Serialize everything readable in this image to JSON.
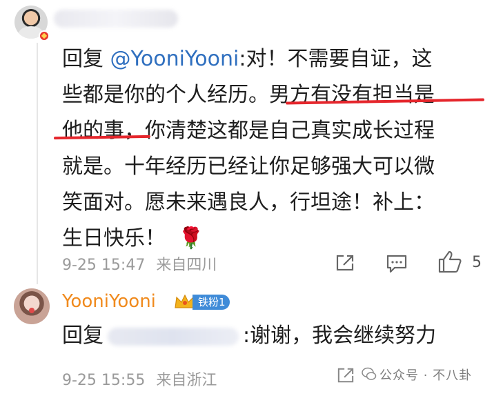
{
  "comment": {
    "reply_prefix": "回复",
    "mention": "@YooniYooni",
    "lines": [
      ":对！不需要自证，这",
      "些都是你的个人经历。男方有没有担当是",
      "他的事，你清楚这都是自己真实成长过程",
      "就是。十年经历已经让你足够强大可以微",
      "笑面对。愿未来遇良人，行坦途！补上：",
      "生日快乐！"
    ],
    "emoji": "🌹",
    "date": "9-25 15:47",
    "location": "来自四川",
    "like_count": "5"
  },
  "reply": {
    "username": "YooniYooni",
    "fan_badge": "铁粉1",
    "reply_prefix": "回复",
    "text": ":谢谢，我会继续努力",
    "date": "9-25 15:55",
    "location": "来自浙江"
  },
  "watermark": "公众号 · 不八卦",
  "icons": {
    "share": "share-icon",
    "comment": "comment-icon",
    "like": "like-icon",
    "crown": "crown-icon"
  },
  "colors": {
    "mention": "#2f6fbf",
    "username": "#f08a1d",
    "underline": "#e5262c",
    "meta": "#9a9a9a",
    "fan_badge": "#3f8bd8"
  }
}
